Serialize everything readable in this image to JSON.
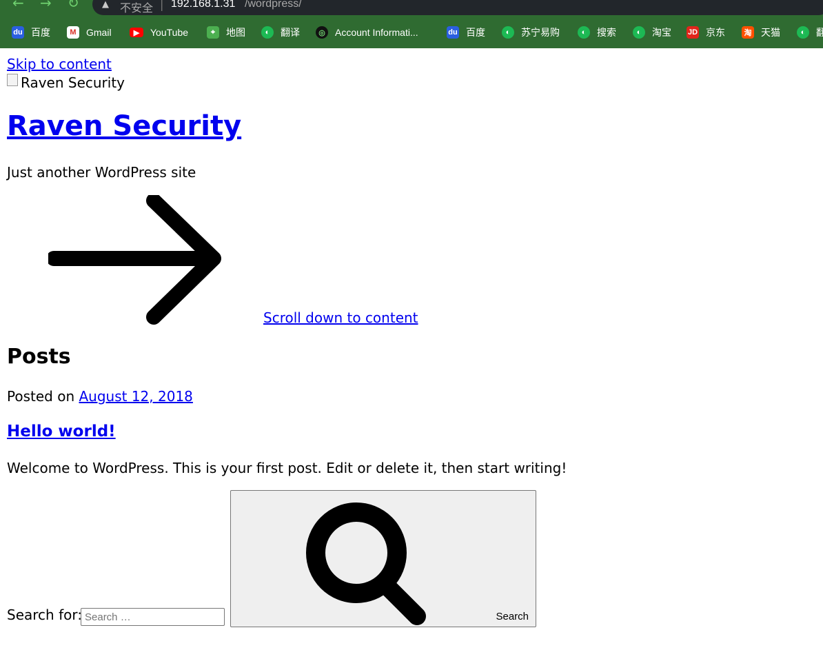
{
  "browser": {
    "security_text": "不安全",
    "url_host": "192.168.1.31",
    "url_path": "/wordpress/",
    "bookmarks": [
      {
        "label": "百度",
        "icon": "baidu-icon"
      },
      {
        "label": "Gmail",
        "icon": "gmail-icon"
      },
      {
        "label": "YouTube",
        "icon": "youtube-icon"
      },
      {
        "label": "地图",
        "icon": "maps-icon"
      },
      {
        "label": "翻译",
        "icon": "globe-icon"
      },
      {
        "label": "Account Informati...",
        "icon": "account-icon"
      },
      {
        "label": "百度",
        "icon": "baidu-icon"
      },
      {
        "label": "苏宁易购",
        "icon": "globe-icon"
      },
      {
        "label": "搜索",
        "icon": "globe-icon"
      },
      {
        "label": "淘宝",
        "icon": "globe-icon"
      },
      {
        "label": "京东",
        "icon": "jd-icon"
      },
      {
        "label": "天猫",
        "icon": "tmall-icon"
      },
      {
        "label": "翻",
        "icon": "globe-icon"
      }
    ]
  },
  "page": {
    "skip_link": "Skip to content",
    "logo_alt": "Raven Security",
    "site_title": "Raven Security",
    "tagline": "Just another WordPress site",
    "scroll_link": "Scroll down to content",
    "posts_heading": "Posts",
    "posted_on_prefix": "Posted on",
    "post_date": "August 12, 2018",
    "post_title": "Hello world!",
    "post_excerpt": "Welcome to WordPress. This is your first post. Edit or delete it, then start writing!",
    "search_label": "Search for:",
    "search_placeholder": "Search …",
    "search_button": "Search"
  }
}
